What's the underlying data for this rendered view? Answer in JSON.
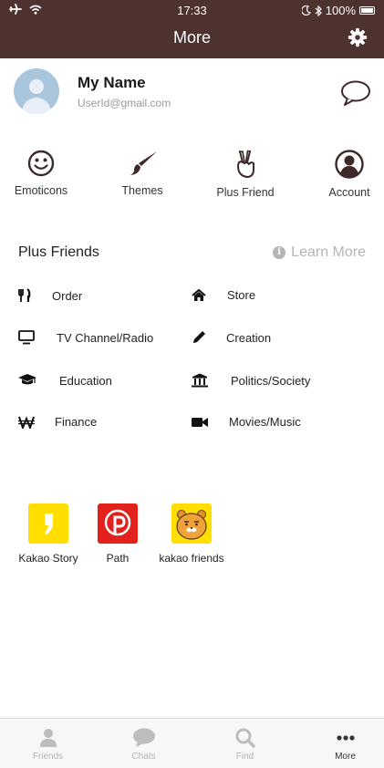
{
  "status_bar": {
    "time": "17:33",
    "battery": "100%"
  },
  "header": {
    "title": "More"
  },
  "profile": {
    "name": "My Name",
    "email": "UserId@gmail.com"
  },
  "quick_actions": [
    {
      "label": "Emoticons",
      "icon": "smiley-icon"
    },
    {
      "label": "Themes",
      "icon": "paintbrush-icon"
    },
    {
      "label": "Plus Friend",
      "icon": "peace-hand-icon"
    },
    {
      "label": "Account",
      "icon": "user-circle-icon"
    }
  ],
  "plus_friends": {
    "title": "Plus Friends",
    "learn_more": "Learn More",
    "categories": [
      {
        "label": "Order",
        "icon": "cutlery-icon"
      },
      {
        "label": "Store",
        "icon": "home-icon"
      },
      {
        "label": "TV Channel/Radio",
        "icon": "monitor-icon"
      },
      {
        "label": "Creation",
        "icon": "pencil-icon"
      },
      {
        "label": "Education",
        "icon": "graduation-cap-icon"
      },
      {
        "label": "Politics/Society",
        "icon": "bank-icon"
      },
      {
        "label": "Finance",
        "icon": "won-icon"
      },
      {
        "label": "Movies/Music",
        "icon": "video-camera-icon"
      }
    ]
  },
  "apps": [
    {
      "label": "Kakao Story",
      "color": "#ffde00"
    },
    {
      "label": "Path",
      "color": "#e2211c"
    },
    {
      "label": "kakao friends",
      "color": "#ffde00"
    }
  ],
  "tabs": [
    {
      "label": "Friends",
      "icon": "person-icon",
      "active": false
    },
    {
      "label": "Chats",
      "icon": "chat-icon",
      "active": false
    },
    {
      "label": "Find",
      "icon": "search-icon",
      "active": false
    },
    {
      "label": "More",
      "icon": "ellipsis-icon",
      "active": true
    }
  ],
  "colors": {
    "header_bg": "#4e3230",
    "icon_dark": "#3d2a28",
    "muted": "#b3b3b3"
  }
}
